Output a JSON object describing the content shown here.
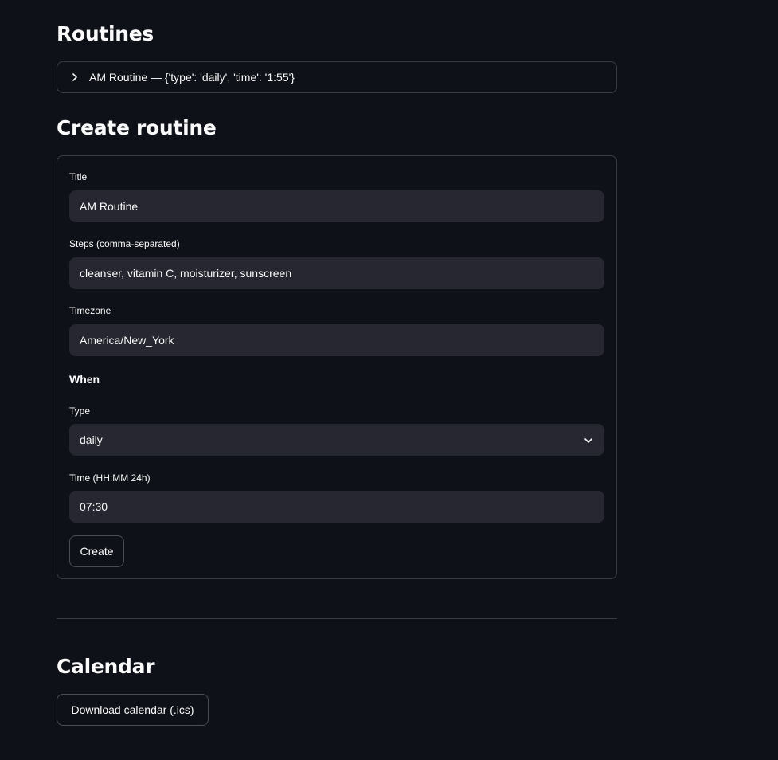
{
  "routines": {
    "heading": "Routines",
    "expander_label": "AM Routine — {'type': 'daily', 'time': '1:55'}"
  },
  "create": {
    "heading": "Create routine",
    "title_label": "Title",
    "title_value": "AM Routine",
    "steps_label": "Steps (comma-separated)",
    "steps_value": "cleanser, vitamin C, moisturizer, sunscreen",
    "timezone_label": "Timezone",
    "timezone_value": "America/New_York",
    "when_heading": "When",
    "type_label": "Type",
    "type_value": "daily",
    "time_label": "Time (HH:MM 24h)",
    "time_value": "07:30",
    "create_button": "Create"
  },
  "calendar": {
    "heading": "Calendar",
    "download_button": "Download calendar (.ics)"
  },
  "icons": {
    "expander": "chevron-right-icon",
    "select": "chevron-down-icon"
  }
}
